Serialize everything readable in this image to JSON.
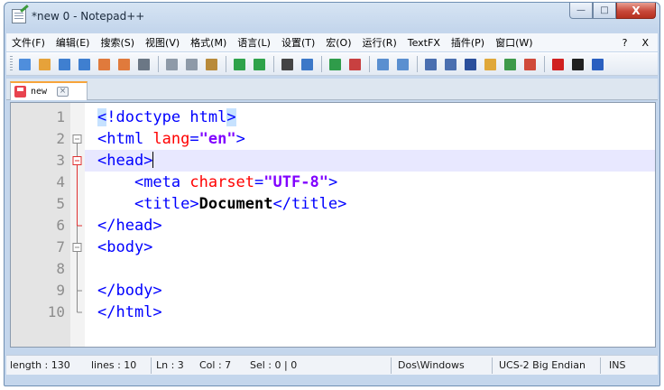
{
  "window": {
    "title": "*new  0 - Notepad++"
  },
  "window_controls": {
    "minimize": "—",
    "maximize": "□",
    "close": "X"
  },
  "menu": {
    "items": [
      "文件(F)",
      "编辑(E)",
      "搜索(S)",
      "视图(V)",
      "格式(M)",
      "语言(L)",
      "设置(T)",
      "宏(O)",
      "运行(R)",
      "TextFX",
      "插件(P)",
      "窗口(W)"
    ],
    "help": "?",
    "close_doc": "X"
  },
  "toolbar": {
    "buttons": [
      {
        "name": "new-file-icon",
        "color": "#4f8edc"
      },
      {
        "name": "open-file-icon",
        "color": "#e6a23a"
      },
      {
        "name": "save-icon",
        "color": "#3f7fd0"
      },
      {
        "name": "save-all-icon",
        "color": "#3f7fd0"
      },
      {
        "name": "close-icon",
        "color": "#e07a3c"
      },
      {
        "name": "close-all-icon",
        "color": "#e07a3c"
      },
      {
        "name": "print-icon",
        "color": "#6b7785"
      },
      {
        "sep": true
      },
      {
        "name": "cut-icon",
        "color": "#8e9aa8"
      },
      {
        "name": "copy-icon",
        "color": "#8e9aa8"
      },
      {
        "name": "paste-icon",
        "color": "#b88a3a"
      },
      {
        "sep": true
      },
      {
        "name": "undo-icon",
        "color": "#2fa24a"
      },
      {
        "name": "redo-icon",
        "color": "#2fa24a"
      },
      {
        "sep": true
      },
      {
        "name": "find-icon",
        "color": "#444444"
      },
      {
        "name": "replace-icon",
        "color": "#3c78c8"
      },
      {
        "sep": true
      },
      {
        "name": "zoom-in-icon",
        "color": "#2f9c4a"
      },
      {
        "name": "zoom-out-icon",
        "color": "#c84040"
      },
      {
        "sep": true
      },
      {
        "name": "sync-vertical-icon",
        "color": "#5a8fd0"
      },
      {
        "name": "sync-horizontal-icon",
        "color": "#5a8fd0"
      },
      {
        "sep": true
      },
      {
        "name": "word-wrap-icon",
        "color": "#4a6fb0"
      },
      {
        "name": "show-all-chars-icon",
        "color": "#4a6fb0"
      },
      {
        "name": "indent-guide-icon",
        "color": "#2a4f9c"
      },
      {
        "name": "language-icon",
        "color": "#e0a83a"
      },
      {
        "name": "doc-map-icon",
        "color": "#3e9a4a"
      },
      {
        "name": "function-list-icon",
        "color": "#d04a3a"
      },
      {
        "sep": true
      },
      {
        "name": "record-macro-icon",
        "color": "#d02020"
      },
      {
        "name": "stop-record-icon",
        "color": "#202020"
      },
      {
        "name": "play-macro-icon",
        "color": "#2a5fc0"
      }
    ]
  },
  "tab": {
    "label": "new",
    "close": "×"
  },
  "editor": {
    "current_line": 3,
    "line_numbers": [
      "1",
      "2",
      "3",
      "4",
      "5",
      "6",
      "7",
      "8",
      "9",
      "10"
    ],
    "fold_markers": [
      "",
      "⊟",
      "⊟",
      "",
      "",
      "",
      "⊟",
      "",
      "",
      ""
    ],
    "lines": [
      [
        {
          "t": "<",
          "c": "tag",
          "m": true
        },
        {
          "t": "!doctype html",
          "c": "tag"
        },
        {
          "t": ">",
          "c": "tag",
          "m": true
        }
      ],
      [
        {
          "t": "<html ",
          "c": "tag"
        },
        {
          "t": "lang",
          "c": "attr"
        },
        {
          "t": "=",
          "c": "tag"
        },
        {
          "t": "\"en\"",
          "c": "str"
        },
        {
          "t": ">",
          "c": "tag"
        }
      ],
      [
        {
          "t": "<head>",
          "c": "tag"
        },
        {
          "t": "",
          "c": "caret"
        }
      ],
      [
        {
          "t": "    ",
          "c": "plain"
        },
        {
          "t": "<meta ",
          "c": "tag"
        },
        {
          "t": "charset",
          "c": "attr"
        },
        {
          "t": "=",
          "c": "tag"
        },
        {
          "t": "\"UTF-8\"",
          "c": "str"
        },
        {
          "t": ">",
          "c": "tag"
        }
      ],
      [
        {
          "t": "    ",
          "c": "plain"
        },
        {
          "t": "<title>",
          "c": "tag"
        },
        {
          "t": "Document",
          "c": "txt"
        },
        {
          "t": "</title>",
          "c": "tag"
        }
      ],
      [
        {
          "t": "</head>",
          "c": "tag"
        }
      ],
      [
        {
          "t": "<body>",
          "c": "tag"
        }
      ],
      [
        {
          "t": "",
          "c": "plain"
        }
      ],
      [
        {
          "t": "</body>",
          "c": "tag"
        }
      ],
      [
        {
          "t": "</html>",
          "c": "tag"
        }
      ]
    ]
  },
  "status": {
    "length": "length : 130",
    "lines": "lines : 10",
    "ln": "Ln : 3",
    "col": "Col : 7",
    "sel": "Sel : 0 | 0",
    "eol": "Dos\\Windows",
    "encoding": "UCS-2 Big Endian",
    "mode": "INS"
  }
}
